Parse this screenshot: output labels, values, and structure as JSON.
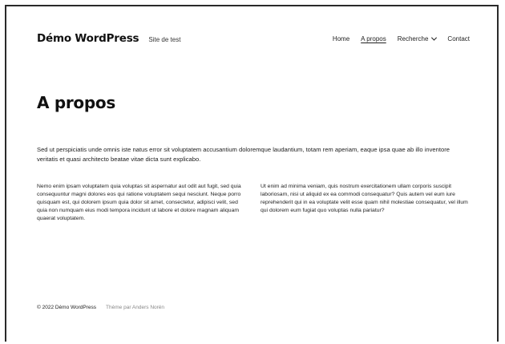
{
  "header": {
    "site_title": "Démo WordPress",
    "tagline": "Site de test",
    "nav": {
      "home": "Home",
      "about": "A propos",
      "search": "Recherche",
      "contact": "Contact"
    },
    "dropdown_icon": "chevron-down-icon"
  },
  "main": {
    "title": "A propos",
    "intro": "Sed ut perspiciatis unde omnis iste natus error sit voluptatem accusantium doloremque laudantium, totam rem aperiam, eaque ipsa quae ab illo inventore veritatis et quasi architecto beatae vitae dicta sunt explicabo.",
    "column_left": "Nemo enim ipsam voluptatem quia voluptas sit aspernatur aut odit aut fugit, sed quia consequuntur magni dolores eos qui ratione voluptatem sequi nesciunt. Neque porro quisquam est, qui dolorem ipsum quia dolor sit amet, consectetur, adipisci velit, sed quia non numquam eius modi tempora incidunt ut labore et dolore magnam aliquam quaerat voluptatem.",
    "column_right": "Ut enim ad minima veniam, quis nostrum exercitationem ullam corporis suscipit laboriosam, nisi ut aliquid ex ea commodi consequatur? Quis autem vel eum iure reprehenderit qui in ea voluptate velit esse quam nihil molestiae consequatur, vel illum qui dolorem eum fugiat quo voluptas nulla pariatur?"
  },
  "footer": {
    "copyright": "© 2022 Démo WordPress",
    "credit": "Thème par Anders Norén"
  },
  "colors": {
    "text": "#1e1e1e",
    "muted": "#888888",
    "background": "#ffffff",
    "frame": "#2a2a2a"
  }
}
